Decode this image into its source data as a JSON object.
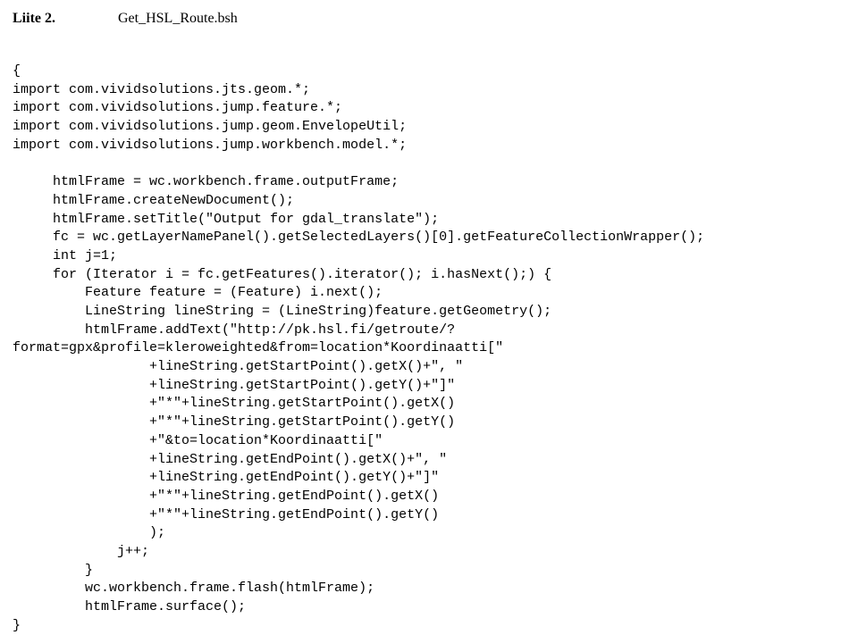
{
  "header": {
    "left": "Liite 2.",
    "right": "Get_HSL_Route.bsh"
  },
  "code": {
    "lines": [
      "{",
      "import com.vividsolutions.jts.geom.*;",
      "import com.vividsolutions.jump.feature.*;",
      "import com.vividsolutions.jump.geom.EnvelopeUtil;",
      "import com.vividsolutions.jump.workbench.model.*;",
      "",
      "     htmlFrame = wc.workbench.frame.outputFrame;",
      "     htmlFrame.createNewDocument();",
      "     htmlFrame.setTitle(\"Output for gdal_translate\");",
      "     fc = wc.getLayerNamePanel().getSelectedLayers()[0].getFeatureCollectionWrapper();",
      "     int j=1;",
      "     for (Iterator i = fc.getFeatures().iterator(); i.hasNext();) {",
      "         Feature feature = (Feature) i.next();",
      "         LineString lineString = (LineString)feature.getGeometry();",
      "         htmlFrame.addText(\"http://pk.hsl.fi/getroute/?",
      "format=gpx&profile=kleroweighted&from=location*Koordinaatti[\"",
      "                 +lineString.getStartPoint().getX()+\", \"",
      "                 +lineString.getStartPoint().getY()+\"]\"",
      "                 +\"*\"+lineString.getStartPoint().getX()",
      "                 +\"*\"+lineString.getStartPoint().getY()",
      "                 +\"&to=location*Koordinaatti[\"",
      "                 +lineString.getEndPoint().getX()+\", \"",
      "                 +lineString.getEndPoint().getY()+\"]\"",
      "                 +\"*\"+lineString.getEndPoint().getX()",
      "                 +\"*\"+lineString.getEndPoint().getY()",
      "                 );",
      "             j++;",
      "         }",
      "         wc.workbench.frame.flash(htmlFrame);",
      "         htmlFrame.surface();",
      "}"
    ]
  }
}
